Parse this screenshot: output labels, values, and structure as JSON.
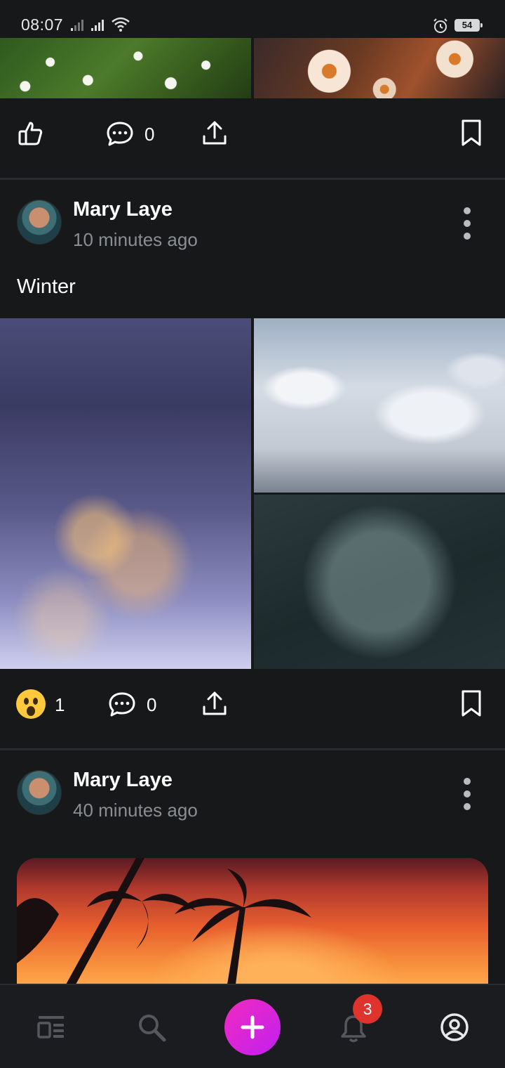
{
  "status_bar": {
    "time": "08:07",
    "battery": "54",
    "icons": [
      "signal-icon",
      "signal-icon",
      "wifi-icon",
      "alarm-icon",
      "battery-icon"
    ]
  },
  "prev_post": {
    "images": [
      "daisy-field-image",
      "daisy-sunset-image"
    ],
    "actions": {
      "comment_count": "0"
    }
  },
  "posts": [
    {
      "author": "Mary Laye",
      "time_ago": "10 minutes ago",
      "text": "Winter",
      "images": [
        "snowy-village-image",
        "snowy-forest-image",
        "snowflake-image"
      ],
      "reaction": {
        "emoji": "astonished-emoji",
        "count": "1"
      },
      "comment_count": "0"
    },
    {
      "author": "Mary Laye",
      "time_ago": "40 minutes ago",
      "images": [
        "palm-sunset-image"
      ]
    }
  ],
  "bottom_nav": {
    "items": [
      "feed-icon",
      "search-icon",
      "add-post-button",
      "notifications-icon",
      "profile-icon"
    ],
    "notification_badge": "3"
  },
  "colors": {
    "background": "#17181a",
    "accent_fab": "#d424d8",
    "badge": "#e0332b",
    "muted_text": "#8a8d92"
  }
}
